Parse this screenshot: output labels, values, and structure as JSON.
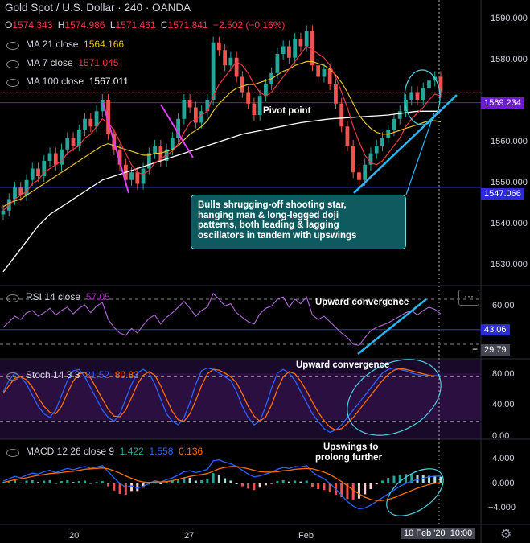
{
  "header": {
    "title": "Gold Spot / U.S. Dollar · 240 · OANDA",
    "ohlc": [
      {
        "key": "O",
        "value": "1574.343"
      },
      {
        "key": "H",
        "value": "1574.986"
      },
      {
        "key": "L",
        "value": "1571.461"
      },
      {
        "key": "C",
        "value": "1571.841"
      }
    ],
    "change": "−2.502 (−0.16%)"
  },
  "ma_legend": [
    {
      "label": "MA 21 close",
      "value": "1564.166",
      "color": "#e6c229"
    },
    {
      "label": "MA 7 close",
      "value": "1571.045",
      "color": "#f23645"
    },
    {
      "label": "MA 100 close",
      "value": "1567.011",
      "color": "#ffffff"
    }
  ],
  "price_axis": {
    "ticks": [
      "1590.000",
      "1580.000",
      "1570.000",
      "1560.000",
      "1550.000",
      "1540.000",
      "1530.000"
    ],
    "tags": [
      {
        "value": "1569.234",
        "color": "#6a1bd1"
      },
      {
        "value": "1547.066",
        "color": "#2a2ad6"
      }
    ]
  },
  "time_axis": {
    "ticks": [
      "20",
      "27",
      "Feb"
    ],
    "cursor_date": "10 Feb '20",
    "cursor_time": "10:00"
  },
  "annotations": {
    "pivot": "Pivot point",
    "callout": [
      "Bulls shrugging-off shooting star,",
      "hanging man & long-legged doji",
      "patterns, both leading & lagging",
      "oscillators in tandem with upswings"
    ],
    "rsi_note": "Upward convergence",
    "stoch_note": "Upward convergence",
    "macd_note": [
      "Upswings to",
      "prolong further"
    ]
  },
  "rsi": {
    "title": "RSI 14 close",
    "value": "57.05",
    "value_color": "#9c27b0",
    "ticks": [
      "60.00"
    ],
    "tags": [
      {
        "value": "43.06",
        "color": "#2a2ad6"
      },
      {
        "value": "29.79",
        "color": "#434651"
      }
    ]
  },
  "stoch": {
    "title": "Stoch 14 3 3",
    "k": "81.52",
    "d": "80.83",
    "k_color": "#2962ff",
    "d_color": "#ff6d00",
    "ticks": [
      "80.00",
      "40.00",
      "0.00"
    ]
  },
  "macd": {
    "title": "MACD 12 26 close 9",
    "hist": "1.422",
    "macd": "1.558",
    "signal": "0.136",
    "ticks": [
      "4.000",
      "0.000",
      "−4.000"
    ]
  },
  "chart_data": {
    "type": "candlestick",
    "title": "Gold Spot / U.S. Dollar · 240 · OANDA",
    "y_range": [
      1522,
      1594
    ],
    "closes": [
      1541,
      1544,
      1547,
      1545,
      1549,
      1552,
      1550,
      1554,
      1556,
      1553,
      1557,
      1560,
      1558,
      1562,
      1565,
      1563,
      1567,
      1570,
      1561,
      1557,
      1553,
      1549,
      1551,
      1548,
      1552,
      1556,
      1558,
      1554,
      1557,
      1560,
      1565,
      1570,
      1568,
      1564,
      1567,
      1570,
      1585,
      1583,
      1579,
      1581,
      1576,
      1572,
      1569,
      1566,
      1571,
      1574,
      1577,
      1582,
      1584,
      1581,
      1586,
      1584,
      1588,
      1579,
      1576,
      1578,
      1574,
      1569,
      1563,
      1558,
      1551,
      1549,
      1553,
      1556,
      1558,
      1560,
      1562,
      1565,
      1567,
      1570,
      1572,
      1570,
      1573,
      1575,
      1576,
      1572
    ],
    "ma21": [
      1542,
      1543,
      1543.5,
      1544,
      1545,
      1546,
      1547,
      1548,
      1549,
      1550,
      1551,
      1552,
      1553,
      1554,
      1555,
      1556,
      1557,
      1558,
      1558.5,
      1558,
      1557.5,
      1557,
      1556.5,
      1556,
      1555.5,
      1555.5,
      1556,
      1556,
      1556.5,
      1557,
      1558,
      1559.5,
      1561,
      1562,
      1563,
      1564.5,
      1567,
      1569,
      1570.5,
      1572,
      1573,
      1573.5,
      1574,
      1574,
      1574.5,
      1575,
      1575.5,
      1576.5,
      1577.5,
      1578,
      1579,
      1579.5,
      1580,
      1580,
      1579.5,
      1579,
      1578,
      1576.5,
      1574.5,
      1572,
      1569,
      1566,
      1564,
      1562.5,
      1561.5,
      1561,
      1561,
      1561.5,
      1562,
      1562.5,
      1563,
      1563.5,
      1564,
      1564.5,
      1564.5,
      1564.2
    ],
    "ma7": [
      1541,
      1542.5,
      1544,
      1545,
      1546,
      1548,
      1549,
      1551,
      1552,
      1553,
      1554,
      1556,
      1557,
      1558,
      1560,
      1561,
      1563,
      1565,
      1564,
      1562,
      1559,
      1556,
      1553,
      1551,
      1550.5,
      1551.5,
      1553.5,
      1554.5,
      1555.5,
      1556.5,
      1558.5,
      1561.5,
      1564,
      1565,
      1566,
      1567,
      1571,
      1574,
      1576,
      1578,
      1580,
      1579,
      1577,
      1574,
      1572,
      1571,
      1572,
      1574,
      1576,
      1578,
      1580,
      1582,
      1584,
      1583,
      1582,
      1581,
      1579,
      1576,
      1572,
      1568,
      1563,
      1559,
      1555.5,
      1553.5,
      1553,
      1554,
      1556,
      1558,
      1560,
      1563,
      1565,
      1566.5,
      1568,
      1570,
      1571.5,
      1571
    ],
    "ma100": [
      1525,
      1527,
      1529,
      1531,
      1533,
      1535,
      1537,
      1538.5,
      1540,
      1541,
      1542,
      1543,
      1544,
      1545,
      1546,
      1547,
      1548,
      1549,
      1549.5,
      1550,
      1550.5,
      1551,
      1551.5,
      1552,
      1552.5,
      1553,
      1553.5,
      1554,
      1554.5,
      1555,
      1555.5,
      1556,
      1556.5,
      1557,
      1557.5,
      1558,
      1558.5,
      1559,
      1559.5,
      1560,
      1560.5,
      1561,
      1561.3,
      1561.6,
      1561.9,
      1562.2,
      1562.5,
      1562.8,
      1563.1,
      1563.4,
      1563.7,
      1564,
      1564.2,
      1564.4,
      1564.6,
      1564.8,
      1565,
      1565.1,
      1565.2,
      1565.3,
      1565.4,
      1565.5,
      1565.6,
      1565.7,
      1565.8,
      1565.9,
      1566,
      1566.2,
      1566.4,
      1566.6,
      1566.8,
      1567,
      1567,
      1567,
      1567,
      1567
    ],
    "rsi_y_range": [
      20,
      80
    ],
    "rsi": [
      45,
      50,
      55,
      52,
      58,
      60,
      55,
      58,
      62,
      56,
      60,
      63,
      57,
      62,
      65,
      58,
      64,
      67,
      52,
      45,
      40,
      38,
      44,
      40,
      47,
      53,
      56,
      48,
      54,
      58,
      63,
      68,
      62,
      55,
      60,
      63,
      75,
      70,
      64,
      66,
      58,
      54,
      50,
      48,
      57,
      62,
      64,
      70,
      72,
      63,
      70,
      66,
      72,
      56,
      52,
      55,
      50,
      45,
      40,
      36,
      30,
      29,
      36,
      42,
      45,
      47,
      49,
      52,
      55,
      58,
      60,
      56,
      60,
      63,
      61,
      57
    ],
    "stoch_y_range": [
      0,
      100
    ],
    "stoch_k": [
      60,
      75,
      85,
      80,
      70,
      55,
      40,
      30,
      25,
      35,
      55,
      75,
      88,
      90,
      80,
      65,
      50,
      35,
      25,
      20,
      30,
      50,
      70,
      85,
      90,
      85,
      70,
      50,
      30,
      20,
      15,
      25,
      45,
      70,
      88,
      92,
      90,
      85,
      80,
      75,
      60,
      40,
      25,
      15,
      20,
      40,
      65,
      85,
      90,
      85,
      75,
      60,
      45,
      30,
      20,
      10,
      5,
      8,
      15,
      25,
      35,
      45,
      55,
      65,
      75,
      85,
      90,
      92,
      90,
      88,
      85,
      83,
      82,
      81,
      81.5,
      81.52
    ],
    "stoch_d": [
      58,
      68,
      78,
      80,
      76,
      66,
      52,
      40,
      32,
      30,
      40,
      58,
      74,
      84,
      86,
      78,
      64,
      50,
      36,
      27,
      26,
      35,
      52,
      70,
      82,
      87,
      82,
      68,
      50,
      33,
      22,
      20,
      30,
      48,
      68,
      84,
      90,
      89,
      85,
      80,
      72,
      57,
      40,
      27,
      20,
      26,
      42,
      63,
      80,
      87,
      84,
      74,
      61,
      46,
      32,
      21,
      12,
      8,
      10,
      17,
      25,
      35,
      45,
      55,
      65,
      75,
      83,
      89,
      91,
      90,
      88,
      86,
      84,
      82,
      81,
      80.83
    ],
    "macd_y_range": [
      -7,
      7
    ],
    "macd_line": [
      0.5,
      1,
      1.5,
      1.2,
      1.8,
      2.2,
      2,
      2.5,
      2.8,
      2.3,
      2.8,
      3.2,
      2.9,
      3.3,
      3.6,
      3.2,
      3.5,
      3.8,
      2.5,
      1.2,
      0,
      -0.8,
      -0.5,
      -1,
      -0.6,
      0,
      0.6,
      0.3,
      0.8,
      1.2,
      1.8,
      2.5,
      2.7,
      2.3,
      2.6,
      3,
      4.8,
      5,
      4.5,
      4.2,
      3.6,
      2.8,
      2,
      1.4,
      1.6,
      2,
      2.4,
      3,
      3.4,
      3.2,
      3.6,
      3.5,
      3.8,
      2.4,
      1.6,
      1,
      0,
      -1.2,
      -2.5,
      -3.8,
      -4.8,
      -5.4,
      -5.2,
      -4.6,
      -3.8,
      -3,
      -2.2,
      -1.4,
      -0.6,
      0,
      0.5,
      0.8,
      1.1,
      1.4,
      1.55,
      1.558
    ],
    "macd_signal": [
      0.2,
      0.5,
      0.8,
      1,
      1.2,
      1.5,
      1.7,
      1.9,
      2.1,
      2.2,
      2.3,
      2.5,
      2.6,
      2.8,
      3,
      3.1,
      3.2,
      3.3,
      3.1,
      2.7,
      2.2,
      1.6,
      1.1,
      0.6,
      0.3,
      0.2,
      0.3,
      0.3,
      0.4,
      0.6,
      0.9,
      1.2,
      1.5,
      1.7,
      1.9,
      2.1,
      2.6,
      3.1,
      3.4,
      3.6,
      3.6,
      3.4,
      3.1,
      2.8,
      2.5,
      2.4,
      2.4,
      2.5,
      2.7,
      2.8,
      3,
      3.1,
      3.2,
      3.1,
      2.8,
      2.4,
      1.9,
      1.2,
      0.4,
      -0.5,
      -1.4,
      -2.2,
      -2.9,
      -3.4,
      -3.6,
      -3.6,
      -3.4,
      -3,
      -2.5,
      -2,
      -1.5,
      -1,
      -0.6,
      -0.2,
      0.05,
      0.136
    ],
    "macd_hist": [
      0.3,
      0.5,
      0.7,
      0.2,
      0.6,
      0.7,
      0.3,
      0.6,
      0.7,
      0.1,
      0.5,
      0.7,
      0.3,
      0.5,
      0.6,
      0.1,
      0.3,
      0.5,
      -0.6,
      -1.5,
      -2.2,
      -2.4,
      -1.6,
      -1.6,
      -0.9,
      -0.2,
      0.3,
      0,
      0.4,
      0.6,
      0.9,
      1.3,
      1.2,
      0.6,
      0.7,
      0.9,
      2.2,
      1.9,
      1.1,
      0.6,
      0,
      -0.6,
      -1.1,
      -1.4,
      -0.9,
      -0.4,
      0,
      0.5,
      0.7,
      0.4,
      0.6,
      0.4,
      0.6,
      -0.7,
      -1.2,
      -1.4,
      -1.9,
      -2.4,
      -2.9,
      -3.3,
      -3.4,
      -3.2,
      -2.3,
      -1.2,
      -0.2,
      0.6,
      1.2,
      1.6,
      1.9,
      2,
      2,
      1.8,
      1.7,
      1.6,
      1.5,
      1.422
    ]
  }
}
